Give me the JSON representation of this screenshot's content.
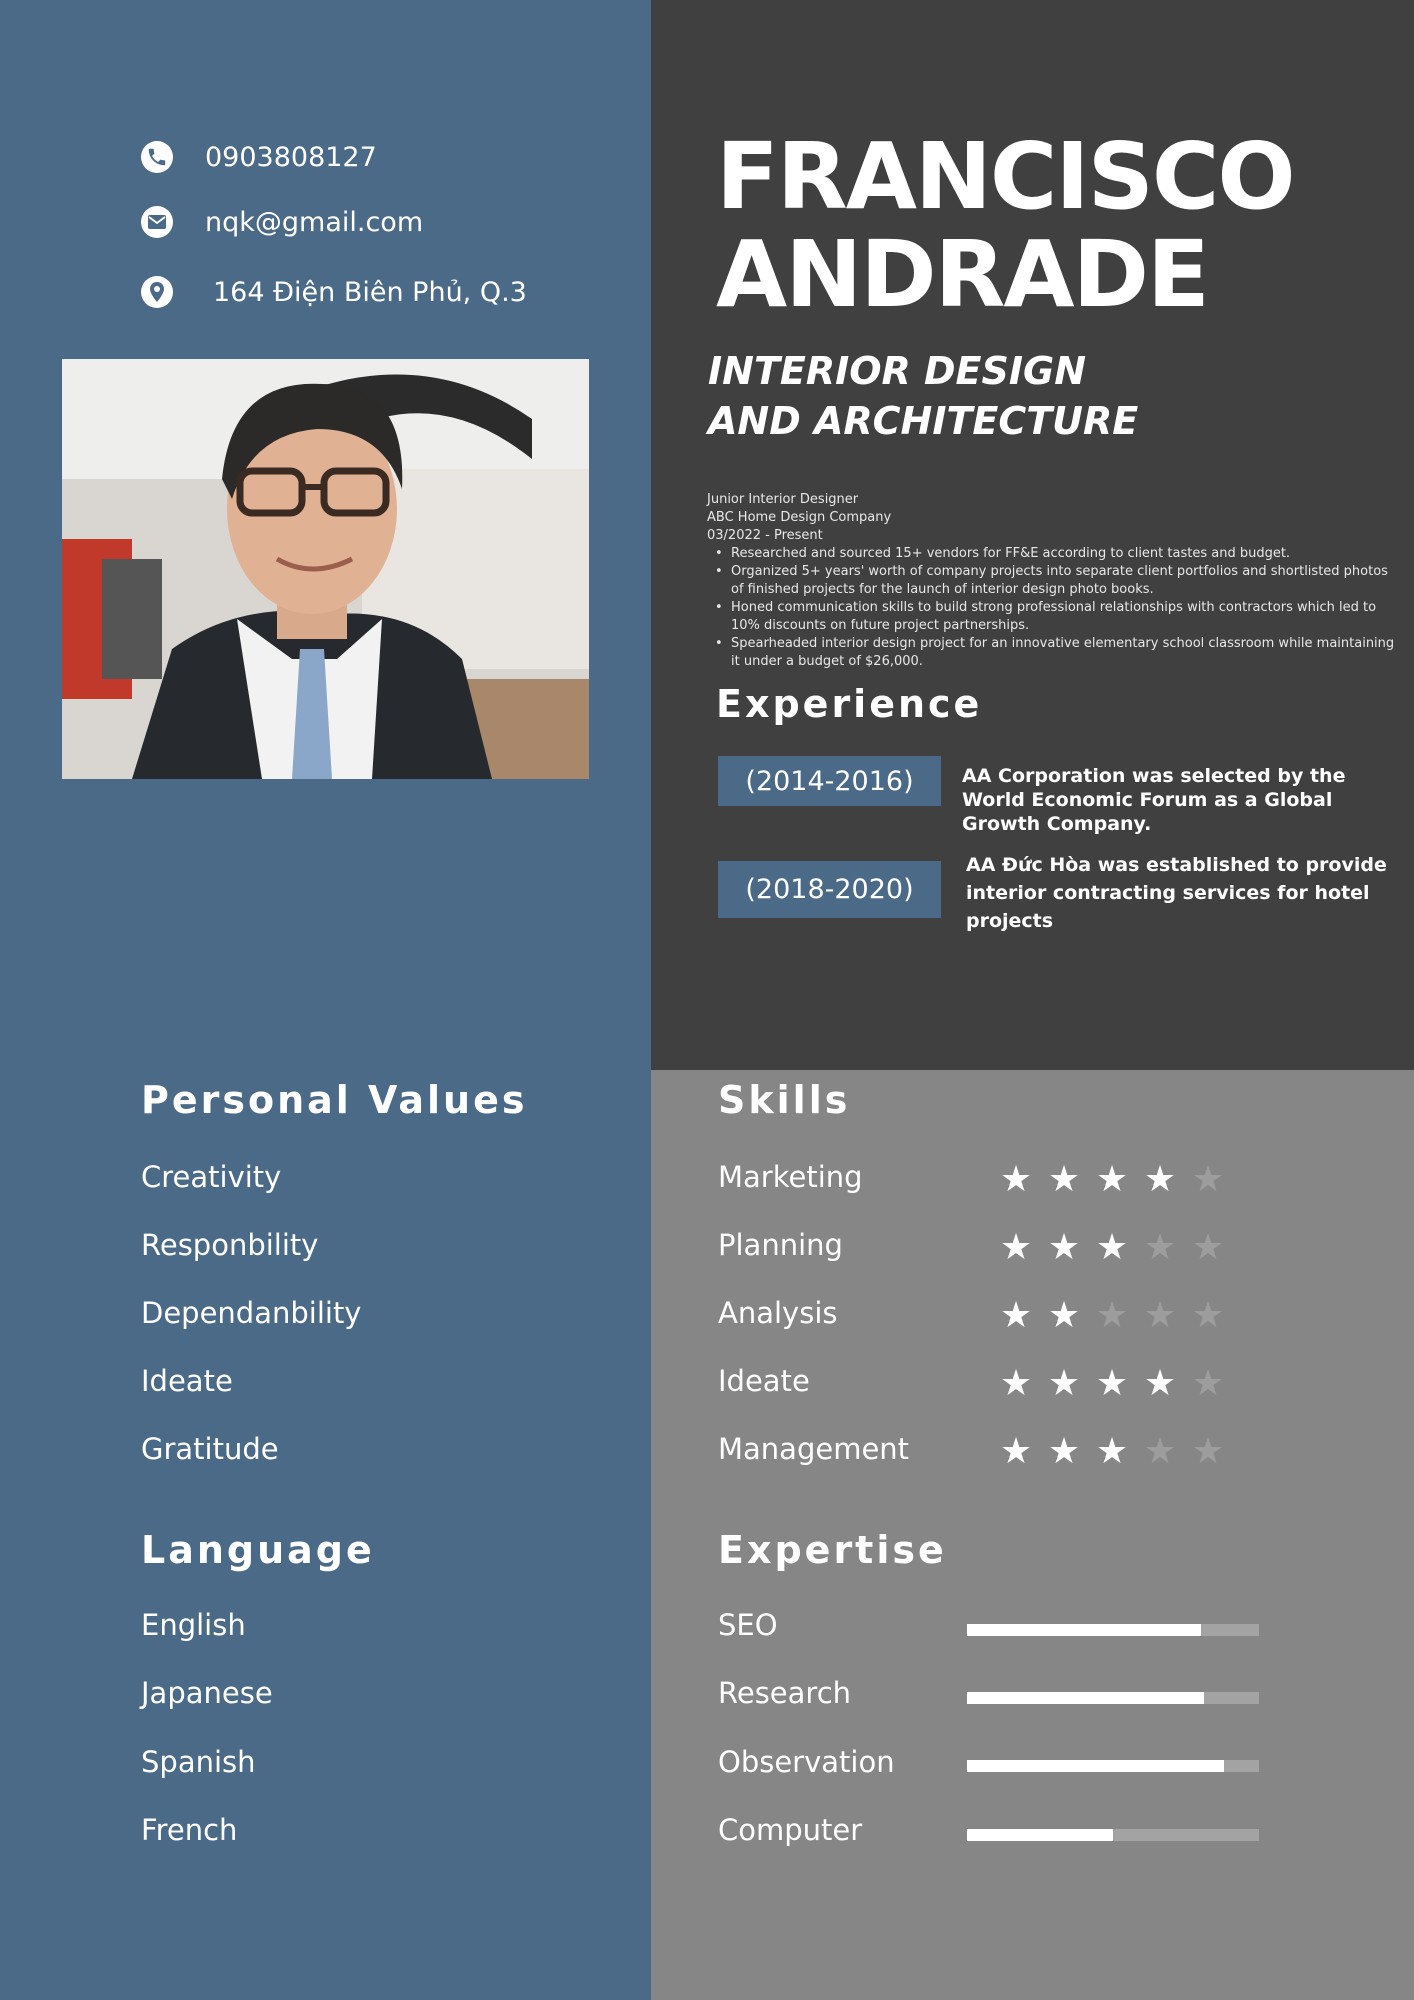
{
  "contact": {
    "phone": "0903808127",
    "email": "nqk@gmail.com",
    "address": "164 Điện Biên Phủ, Q.3"
  },
  "header": {
    "name_line1": "FRANCISCO",
    "name_line2": "ANDRADE",
    "title_line1": "INTERIOR DESIGN",
    "title_line2": "AND ARCHITECTURE"
  },
  "job": {
    "position": "Junior Interior Designer",
    "company": "ABC Home Design Company",
    "period": "03/2022 - Present",
    "bullets": [
      "Researched and sourced 15+ vendors for FF&E according to client tastes and budget.",
      "Organized 5+ years' worth of company projects into separate client portfolios and shortlisted photos of finished projects for the launch of interior design photo books.",
      "Honed communication skills to build strong professional relationships with contractors which led to 10% discounts on future project partnerships.",
      "Spearheaded interior design project for an innovative elementary school classroom while maintaining it under a budget of $26,000."
    ]
  },
  "experience": {
    "heading": "Experience",
    "items": [
      {
        "years": "(2014-2016)",
        "text": "AA Corporation was selected by the World Economic Forum as a Global Growth Company."
      },
      {
        "years": "(2018-2020)",
        "text": "AA Đức Hòa was established to provide interior contracting services for hotel projects"
      }
    ]
  },
  "values": {
    "heading": "Personal Values",
    "items": [
      "Creativity",
      "Responbility",
      "Dependanbility",
      "Ideate",
      "Gratitude"
    ]
  },
  "language": {
    "heading": "Language",
    "items": [
      "English",
      "Japanese",
      "Spanish",
      "French"
    ]
  },
  "skills": {
    "heading": "Skills",
    "items": [
      {
        "name": "Marketing",
        "rating": 4
      },
      {
        "name": "Planning",
        "rating": 3
      },
      {
        "name": "Analysis",
        "rating": 2
      },
      {
        "name": "Ideate",
        "rating": 4
      },
      {
        "name": "Management",
        "rating": 3
      }
    ],
    "max_rating": 5
  },
  "expertise": {
    "heading": "Expertise",
    "items": [
      {
        "name": "SEO",
        "level": 0.8
      },
      {
        "name": "Research",
        "level": 0.81
      },
      {
        "name": "Observation",
        "level": 0.88
      },
      {
        "name": "Computer",
        "level": 0.5
      }
    ]
  },
  "colors": {
    "left_panel": "#4b6a88",
    "dark_panel": "#404040",
    "grey_panel": "#868686",
    "star_off": "#9d9d9d"
  },
  "icons": [
    "phone-icon",
    "email-icon",
    "location-icon",
    "star-icon"
  ]
}
